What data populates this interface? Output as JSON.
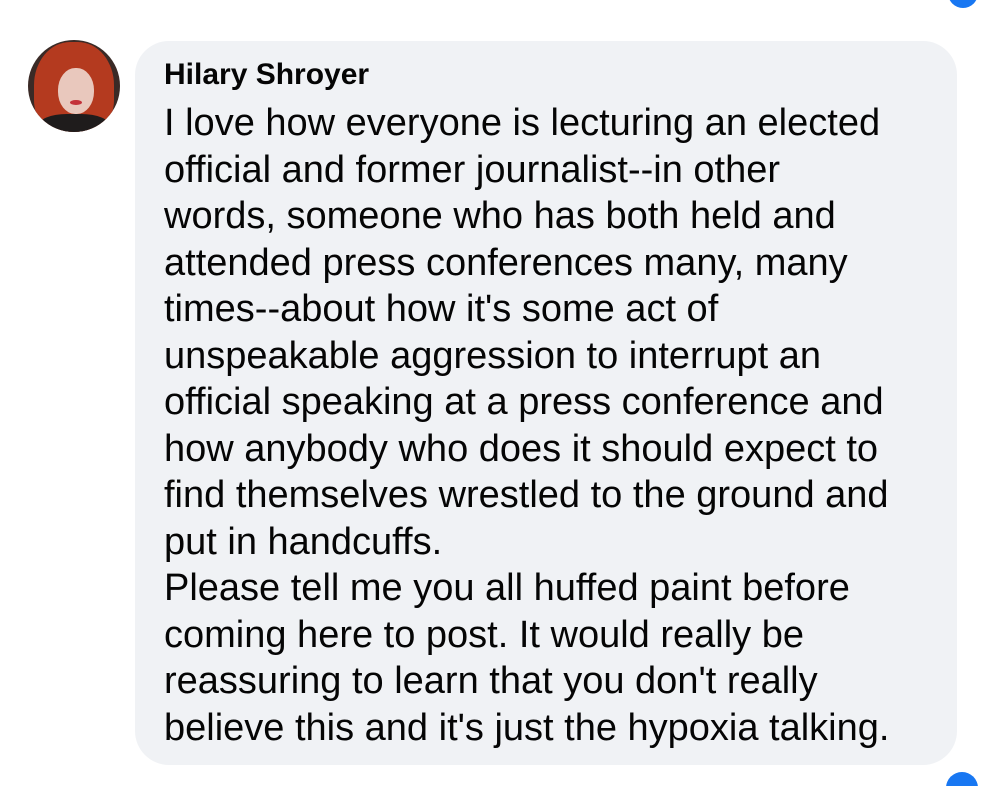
{
  "comment": {
    "author": "Hilary Shroyer",
    "lines": [
      "I love how everyone is lecturing an elected",
      "official and former journalist--in other",
      "words, someone who has both held and",
      "attended press conferences many, many",
      "times--about how it's some act of",
      "unspeakable aggression to interrupt an",
      "official speaking at a press conference and",
      "how anybody who does it should expect to",
      "find themselves wrestled to the ground and",
      "put in handcuffs.",
      "Please tell me you all huffed paint before",
      "coming here to post. It would really be",
      "reassuring to learn that you don't really",
      "believe this and it's just the hypoxia talking."
    ]
  },
  "partial_top": {
    "reaction_icon": "like-reaction-icon"
  },
  "partial_bottom": {
    "reaction_icon": "like-reaction-icon",
    "colors": {
      "link": "#1877f2",
      "meta": "#65676b"
    }
  },
  "colors": {
    "bubble": "#f0f2f5",
    "text": "#050505",
    "accent": "#1877f2"
  }
}
